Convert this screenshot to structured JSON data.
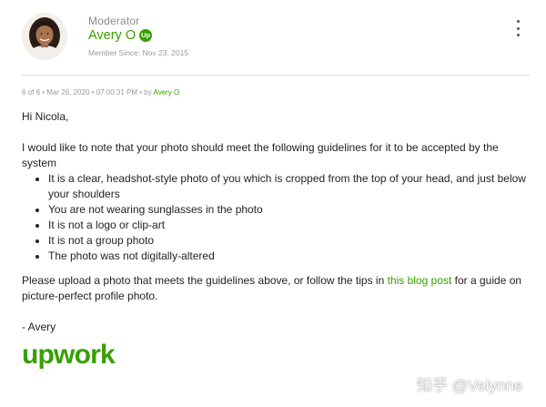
{
  "post": {
    "role": "Moderator",
    "author_name": "Avery O",
    "author_badge": "Up",
    "member_since": "Member Since: Nov 23, 2015",
    "meta_prefix": "6 of 6 • Mar 26, 2020 • 07:00:31 PM • by ",
    "meta_author": "Avery O"
  },
  "message": {
    "greeting": "Hi Nicola,",
    "intro": "I would like to note that your photo should meet the following guidelines for it to be accepted by the system",
    "guidelines": [
      "It is a clear, headshot-style photo of you which is cropped from the top of your head, and just below your shoulders",
      "You are not wearing sunglasses in the photo",
      "It is not a logo or clip-art",
      "It is not a group photo",
      "The photo was not digitally-altered"
    ],
    "closing_before_link": "Please upload a photo that meets the guidelines above, or follow the tips in ",
    "closing_link": "this blog post",
    "closing_after_link": " for a guide on picture-perfect profile photo.",
    "signoff": "- Avery"
  },
  "logo": {
    "brand_text": "upwork"
  },
  "watermark": {
    "text": "知乎 @Velynne"
  },
  "icons": {
    "avatar": "user-avatar",
    "badge": "upwork-badge-icon",
    "menu": "kebab-menu-icon"
  },
  "colors": {
    "brand_green": "#37a000",
    "muted_text": "#9a9a9a",
    "body_text": "#222222",
    "divider": "#dedede"
  }
}
